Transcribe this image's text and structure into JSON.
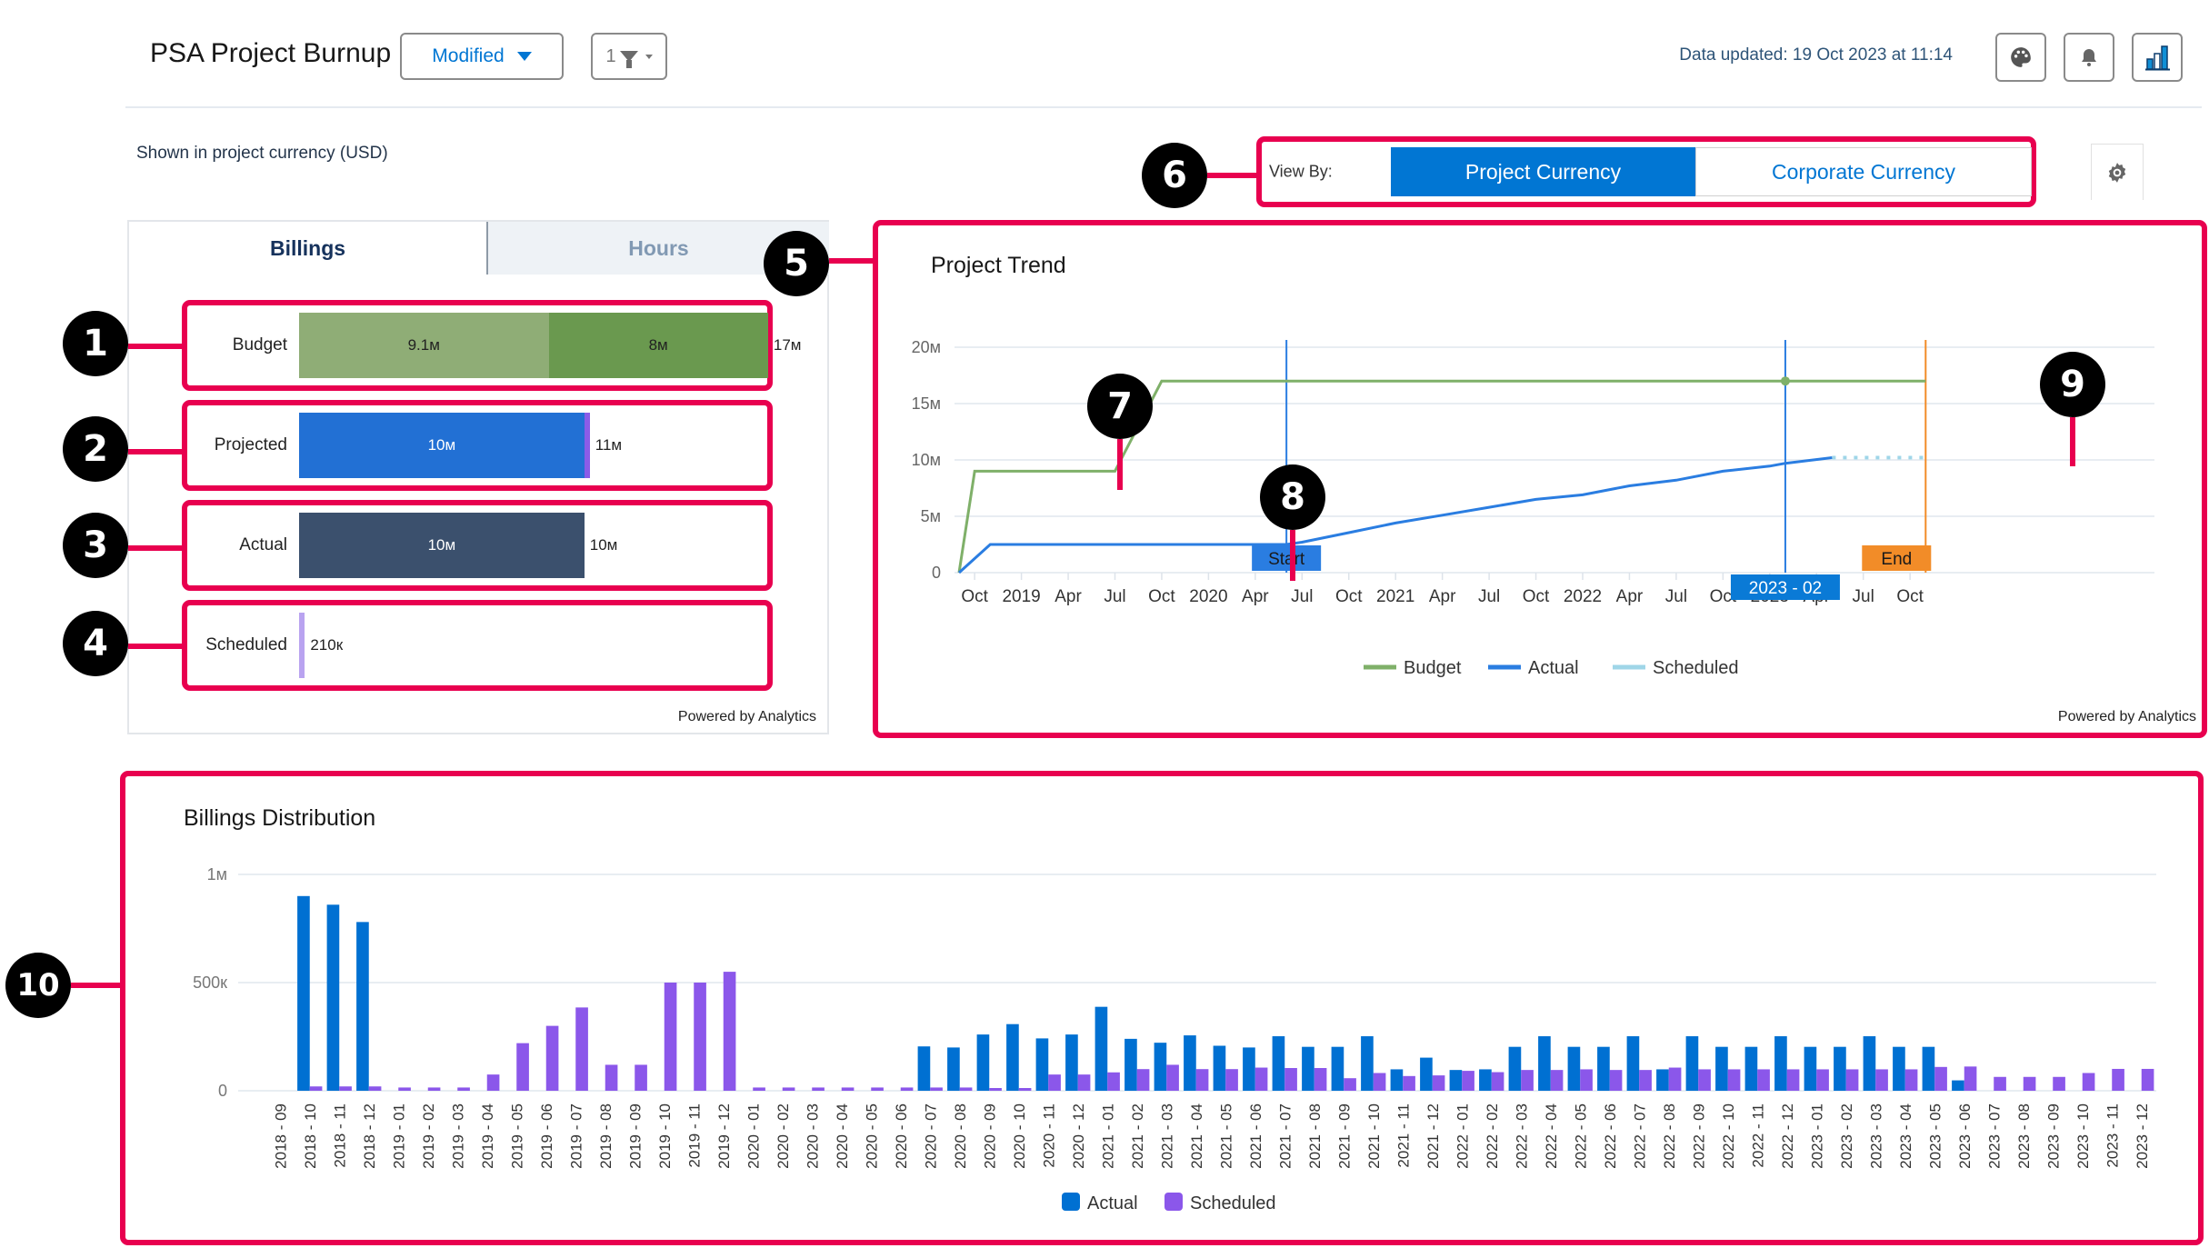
{
  "header": {
    "title": "PSA Project Burnup",
    "state_button": "Modified",
    "filter_count": "1",
    "data_updated": "Data updated: 19 Oct 2023 at 11:14",
    "icons": [
      "palette-icon",
      "bell-icon",
      "bar-chart-icon"
    ]
  },
  "currency_note": "Shown in project currency (USD)",
  "view_by": {
    "label": "View By:",
    "options": [
      "Project Currency",
      "Corporate Currency"
    ],
    "selected": "Project Currency"
  },
  "summary_panel": {
    "tabs": [
      "Billings",
      "Hours"
    ],
    "active_tab": "Billings",
    "rows": [
      {
        "label": "Budget",
        "segments": [
          {
            "value": 9.1,
            "text": "9.1м",
            "color": "#8fad76"
          },
          {
            "value": 8.0,
            "text": "8м",
            "color": "#6a994f"
          }
        ],
        "total": "17м"
      },
      {
        "label": "Projected",
        "segments": [
          {
            "value": 10.4,
            "text": "10м",
            "color": "#2270d4"
          },
          {
            "value": 0.2,
            "text": "",
            "color": "#8a5ce8"
          }
        ],
        "total": "11м"
      },
      {
        "label": "Actual",
        "segments": [
          {
            "value": 10.4,
            "text": "10м",
            "color": "#3b506d"
          }
        ],
        "total": "10м"
      },
      {
        "label": "Scheduled",
        "segments": [
          {
            "value": 0.21,
            "text": "",
            "color": "#b9a3f0"
          }
        ],
        "total": "210к"
      }
    ],
    "scale_max": 17.9,
    "powered_by": "Powered by Analytics"
  },
  "annotations": [
    "1",
    "2",
    "3",
    "4",
    "5",
    "6",
    "7",
    "8",
    "9",
    "10"
  ],
  "chart_data": [
    {
      "type": "line",
      "title": "Project Trend",
      "x_tick_labels": [
        "Oct",
        "2019",
        "Apr",
        "Jul",
        "Oct",
        "2020",
        "Apr",
        "Jul",
        "Oct",
        "2021",
        "Apr",
        "Jul",
        "Oct",
        "2022",
        "Apr",
        "Jul",
        "Oct",
        "2023",
        "Apr",
        "Jul",
        "Oct"
      ],
      "x_start": "2018-09",
      "y_tick_labels": [
        "0",
        "5м",
        "10м",
        "15м",
        "20м"
      ],
      "ylim": [
        0,
        20
      ],
      "yunit": "M USD",
      "grid": true,
      "legend": {
        "position": "bottom",
        "entries": [
          "Budget",
          "Actual",
          "Scheduled"
        ]
      },
      "series": [
        {
          "name": "Budget",
          "color": "#7fb069",
          "points": [
            [
              "2018-09",
              0
            ],
            [
              "2018-10",
              9
            ],
            [
              "2019-07",
              9
            ],
            [
              "2019-10",
              17
            ],
            [
              "2023-11",
              17
            ]
          ]
        },
        {
          "name": "Actual",
          "color": "#2a7de1",
          "points": [
            [
              "2018-09",
              0
            ],
            [
              "2018-11",
              2.5
            ],
            [
              "2020-06",
              2.5
            ],
            [
              "2020-07",
              2.7
            ],
            [
              "2020-10",
              3.55
            ],
            [
              "2021-01",
              4.4
            ],
            [
              "2021-04",
              5.1
            ],
            [
              "2021-07",
              5.8
            ],
            [
              "2021-10",
              6.5
            ],
            [
              "2022-01",
              6.9
            ],
            [
              "2022-04",
              7.7
            ],
            [
              "2022-07",
              8.2
            ],
            [
              "2022-10",
              9.0
            ],
            [
              "2023-01",
              9.45
            ],
            [
              "2023-02",
              9.7
            ],
            [
              "2023-05",
              10.2
            ]
          ]
        },
        {
          "name": "Scheduled",
          "color": "#9fd6e8",
          "dashed": true,
          "points": [
            [
              "2023-05",
              10.2
            ],
            [
              "2023-11",
              10.2
            ]
          ]
        }
      ],
      "markers": [
        {
          "label": "Start",
          "date": "2020-06",
          "color": "#2a7de1"
        },
        {
          "label": "2023 - 02",
          "date": "2023-02",
          "color": "#2a7de1"
        },
        {
          "label": "End",
          "date": "2023-11",
          "color": "#f28c28"
        }
      ],
      "powered_by": "Powered by Analytics"
    },
    {
      "type": "bar",
      "title": "Billings Distribution",
      "categories": [
        "2018 - 09",
        "2018 - 10",
        "2018 - 11",
        "2018 - 12",
        "2019 - 01",
        "2019 - 02",
        "2019 - 03",
        "2019 - 04",
        "2019 - 05",
        "2019 - 06",
        "2019 - 07",
        "2019 - 08",
        "2019 - 09",
        "2019 - 10",
        "2019 - 11",
        "2019 - 12",
        "2020 - 01",
        "2020 - 02",
        "2020 - 03",
        "2020 - 04",
        "2020 - 05",
        "2020 - 06",
        "2020 - 07",
        "2020 - 08",
        "2020 - 09",
        "2020 - 10",
        "2020 - 11",
        "2020 - 12",
        "2021 - 01",
        "2021 - 02",
        "2021 - 03",
        "2021 - 04",
        "2021 - 05",
        "2021 - 06",
        "2021 - 07",
        "2021 - 08",
        "2021 - 09",
        "2021 - 10",
        "2021 - 11",
        "2021 - 12",
        "2022 - 01",
        "2022 - 02",
        "2022 - 03",
        "2022 - 04",
        "2022 - 05",
        "2022 - 06",
        "2022 - 07",
        "2022 - 08",
        "2022 - 09",
        "2022 - 10",
        "2022 - 11",
        "2022 - 12",
        "2023 - 01",
        "2023 - 02",
        "2023 - 03",
        "2023 - 04",
        "2023 - 05",
        "2023 - 06",
        "2023 - 07",
        "2023 - 08",
        "2023 - 09",
        "2023 - 10",
        "2023 - 11",
        "2023 - 12"
      ],
      "series": [
        {
          "name": "Actual",
          "color": "#0070d2",
          "values": [
            0,
            900,
            860,
            780,
            0,
            0,
            0,
            0,
            0,
            0,
            0,
            0,
            0,
            0,
            0,
            0,
            0,
            0,
            0,
            0,
            0,
            0,
            205,
            200,
            260,
            308,
            242,
            260,
            388,
            240,
            222,
            256,
            208,
            200,
            252,
            203,
            203,
            252,
            99,
            153,
            96,
            99,
            203,
            252,
            203,
            203,
            252,
            99,
            252,
            203,
            203,
            252,
            203,
            203,
            252,
            203,
            203,
            48,
            0,
            0,
            0,
            0,
            0,
            0
          ]
        },
        {
          "name": "Scheduled",
          "color": "#8b57ea",
          "values": [
            0,
            20,
            20,
            20,
            15,
            15,
            15,
            75,
            220,
            300,
            385,
            120,
            120,
            500,
            500,
            550,
            15,
            15,
            15,
            15,
            15,
            15,
            15,
            15,
            12,
            12,
            75,
            75,
            85,
            100,
            120,
            100,
            100,
            107,
            105,
            105,
            58,
            82,
            68,
            71,
            92,
            86,
            96,
            96,
            99,
            96,
            96,
            107,
            99,
            99,
            99,
            99,
            99,
            99,
            99,
            99,
            110,
            112,
            64,
            64,
            64,
            82,
            101,
            101
          ]
        }
      ],
      "yunit": "K USD",
      "ylim": [
        0,
        1000
      ],
      "y_tick_labels": [
        "0",
        "500к",
        "1м"
      ],
      "grid": true,
      "legend": {
        "position": "bottom",
        "entries": [
          "Actual",
          "Scheduled"
        ]
      }
    }
  ]
}
